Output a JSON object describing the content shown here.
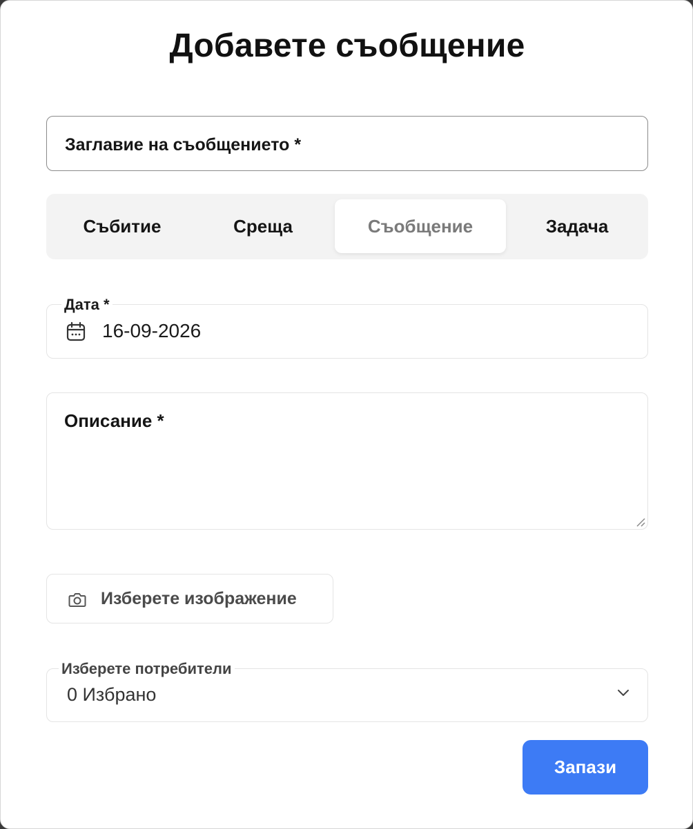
{
  "dialog": {
    "title": "Добавете съобщение"
  },
  "title_field": {
    "placeholder": "Заглавие на съобщението *"
  },
  "tabs": [
    {
      "label": "Събитие",
      "selected": false
    },
    {
      "label": "Среща",
      "selected": false
    },
    {
      "label": "Съобщение",
      "selected": true
    },
    {
      "label": "Задача",
      "selected": false
    }
  ],
  "date_field": {
    "label": "Дата *",
    "value": "16-09-2026",
    "icon": "calendar-icon"
  },
  "description_field": {
    "placeholder": "Описание *"
  },
  "image_button": {
    "label": "Изберете изображение",
    "icon": "camera-icon"
  },
  "users_select": {
    "label": "Изберете потребители",
    "value": "0 Избрано",
    "icon": "chevron-down-icon"
  },
  "save_button": {
    "label": "Запази"
  },
  "colors": {
    "primary": "#3d7bf5",
    "tab_bar_bg": "#f3f3f3",
    "selected_tab_text": "#7a7a7a"
  }
}
